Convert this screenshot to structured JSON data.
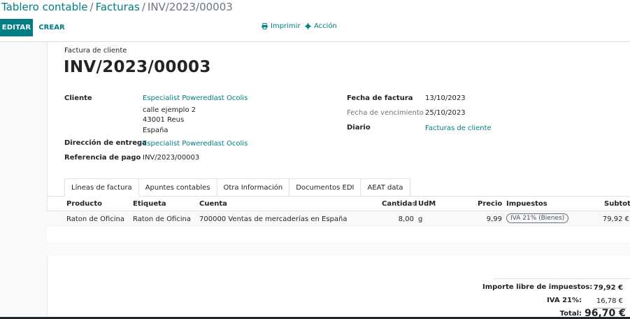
{
  "breadcrumb": {
    "part1": "Tablero contable",
    "part2": "Facturas",
    "current": "INV/2023/00003"
  },
  "toolbar": {
    "edit": "EDITAR",
    "create": "CREAR",
    "print": "Imprimir",
    "action": "Acción"
  },
  "document": {
    "type": "Factura de cliente",
    "number": "INV/2023/00003"
  },
  "left_fields": {
    "customer_label": "Cliente",
    "customer_name": "Especialist Poweredlast Ocolis",
    "address_line1": "calle ejemplo 2",
    "address_line2": "43001 Reus",
    "address_line3": "España",
    "delivery_label": "Dirección de entrega",
    "delivery_value": "Especialist Poweredlast Ocolis",
    "payment_ref_label": "Referencia de pago",
    "payment_ref_value": "INV/2023/00003"
  },
  "right_fields": {
    "invoice_date_label": "Fecha de factura",
    "invoice_date_value": "13/10/2023",
    "due_date_label": "Fecha de vencimiento",
    "due_date_value": "25/10/2023",
    "journal_label": "Diario",
    "journal_value": "Facturas de cliente"
  },
  "tabs": [
    "Líneas de factura",
    "Apuntes contables",
    "Otra Información",
    "Documentos EDI",
    "AEAT data"
  ],
  "table": {
    "headers": {
      "product": "Producto",
      "label": "Etiqueta",
      "account": "Cuenta",
      "quantity": "Cantidad",
      "uom": "UdM",
      "price": "Precio",
      "taxes": "Impuestos",
      "subtotal": "Subtotal"
    },
    "rows": [
      {
        "product": "Raton de Oficina",
        "label": "Raton de Oficina",
        "account": "700000 Ventas de mercaderías en España",
        "quantity": "8,00",
        "uom": "g",
        "price": "9,99",
        "tax": "IVA 21% (Bienes)",
        "subtotal": "79,92 €"
      }
    ]
  },
  "totals": {
    "untaxed_label": "Importe libre de impuestos:",
    "untaxed_value": "79,92 €",
    "tax_label": "IVA 21%:",
    "tax_value": "16,78 €",
    "total_label": "Total:",
    "total_value": "96,70 €"
  },
  "colors": {
    "accent": "#017e84",
    "text": "#212529",
    "muted": "#6c757d"
  }
}
